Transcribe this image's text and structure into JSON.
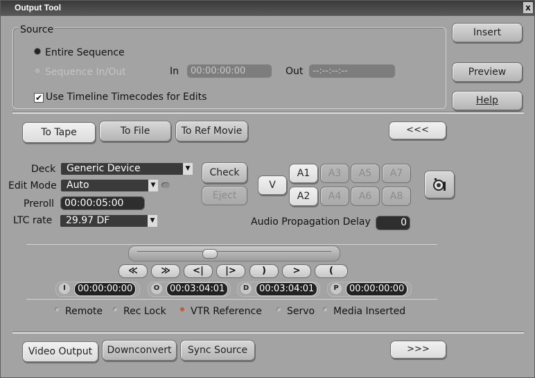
{
  "window": {
    "title": "Output Tool",
    "close_label": "x"
  },
  "source": {
    "group_label": "Source",
    "entire_sequence": "Entire Sequence",
    "sequence_in_out": "Sequence In/Out",
    "in_label": "In",
    "in_value": "00:00:00:00",
    "out_label": "Out",
    "out_value": "--:--:--:--",
    "use_timeline": "Use Timeline Timecodes for Edits"
  },
  "side_buttons": {
    "insert": "Insert",
    "preview": "Preview",
    "help": "Help"
  },
  "tabs": {
    "to_tape": "To Tape",
    "to_file": "To File",
    "to_ref_movie": "To Ref Movie",
    "collapse": "<<<"
  },
  "deck": {
    "deck_label": "Deck",
    "deck_value": "Generic Device",
    "edit_mode_label": "Edit Mode",
    "edit_mode_value": "Auto",
    "preroll_label": "Preroll",
    "preroll_value": "00:00:05:00",
    "ltc_label": "LTC rate",
    "ltc_value": "29.97 DF",
    "check": "Check",
    "eject": "Eject"
  },
  "tracks": {
    "v": "V",
    "a1": "A1",
    "a2": "A2",
    "a3": "A3",
    "a4": "A4",
    "a5": "A5",
    "a6": "A6",
    "a7": "A7",
    "a8": "A8"
  },
  "audio_delay": {
    "label": "Audio Propagation Delay",
    "value": "0"
  },
  "transport": {
    "rewind": "≪",
    "ffwd": "≫",
    "step_back": "<|",
    "step_fwd": "|>",
    "mark_out": ")",
    "play": ">",
    "mark_in": "("
  },
  "timecodes": {
    "i_key": "I",
    "i_value": "00:00:00:00",
    "o_key": "O",
    "o_value": "00:03:04:01",
    "d_key": "D",
    "d_value": "00:03:04:01",
    "p_key": "P",
    "p_value": "00:00:00:00"
  },
  "status": {
    "remote": "Remote",
    "rec_lock": "Rec Lock",
    "vtr_reference": "VTR Reference",
    "servo": "Servo",
    "media_inserted": "Media Inserted",
    "vtr_reference_color": "#d9552b"
  },
  "bottom_tabs": {
    "video_output": "Video Output",
    "downconvert": "Downconvert",
    "sync_source": "Sync Source",
    "expand": ">>>"
  }
}
